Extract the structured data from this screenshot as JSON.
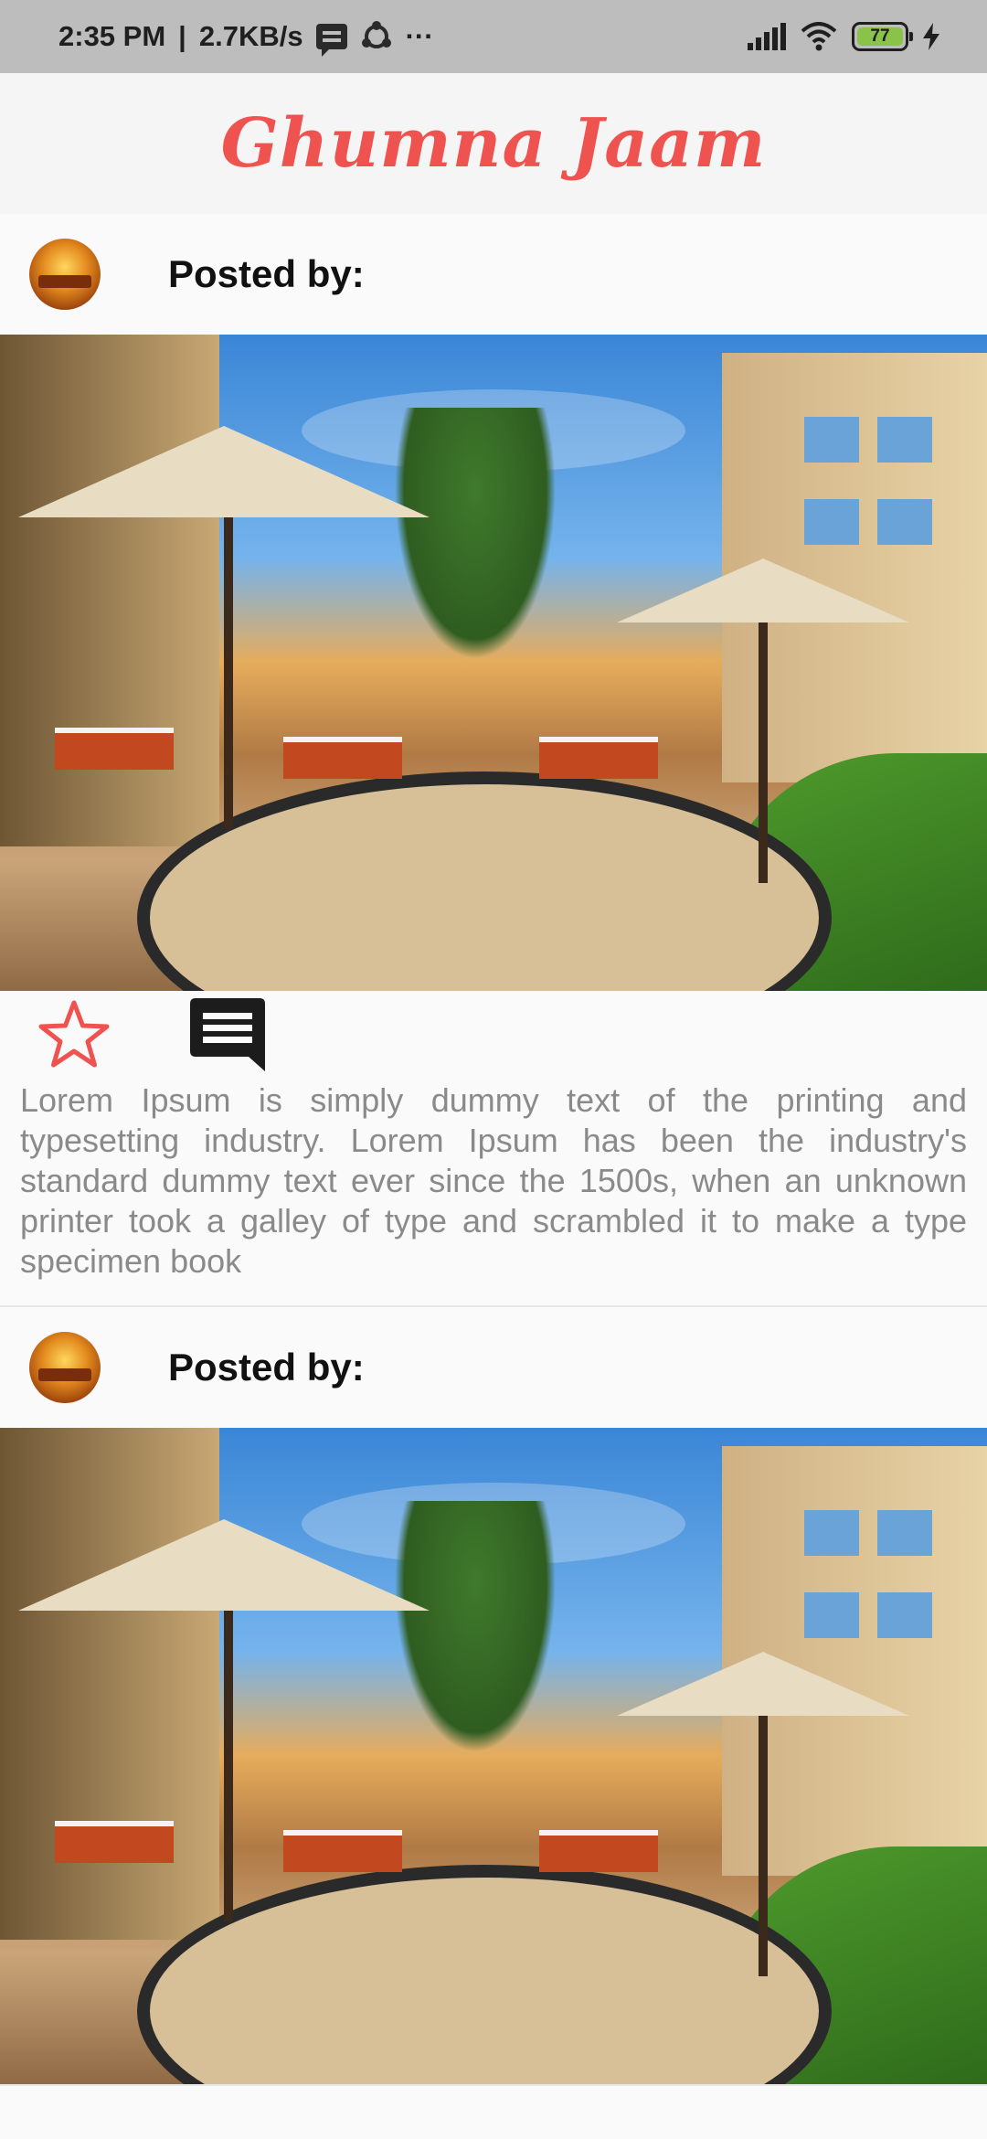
{
  "status_bar": {
    "time": "2:35 PM",
    "separator": "|",
    "speed": "2.7KB/s",
    "more": "···",
    "battery": "77",
    "icons": [
      "message-icon",
      "sync-icon",
      "signal-icon",
      "wifi-icon",
      "battery-icon",
      "charging-icon"
    ]
  },
  "app": {
    "title": "Ghumna Jaam",
    "accent": "#ef5350"
  },
  "posts": [
    {
      "posted_by_label": "Posted by:",
      "image": "restaurant-garden-photo",
      "text": "Lorem Ipsum is simply dummy text of the printing and typesetting industry. Lorem Ipsum has been the industry's standard dummy text ever since the 1500s, when an unknown printer took a galley of type and scrambled it to make a type specimen book",
      "actions": [
        "star-icon",
        "comment-icon"
      ]
    },
    {
      "posted_by_label": "Posted by:",
      "image": "restaurant-garden-photo"
    }
  ]
}
